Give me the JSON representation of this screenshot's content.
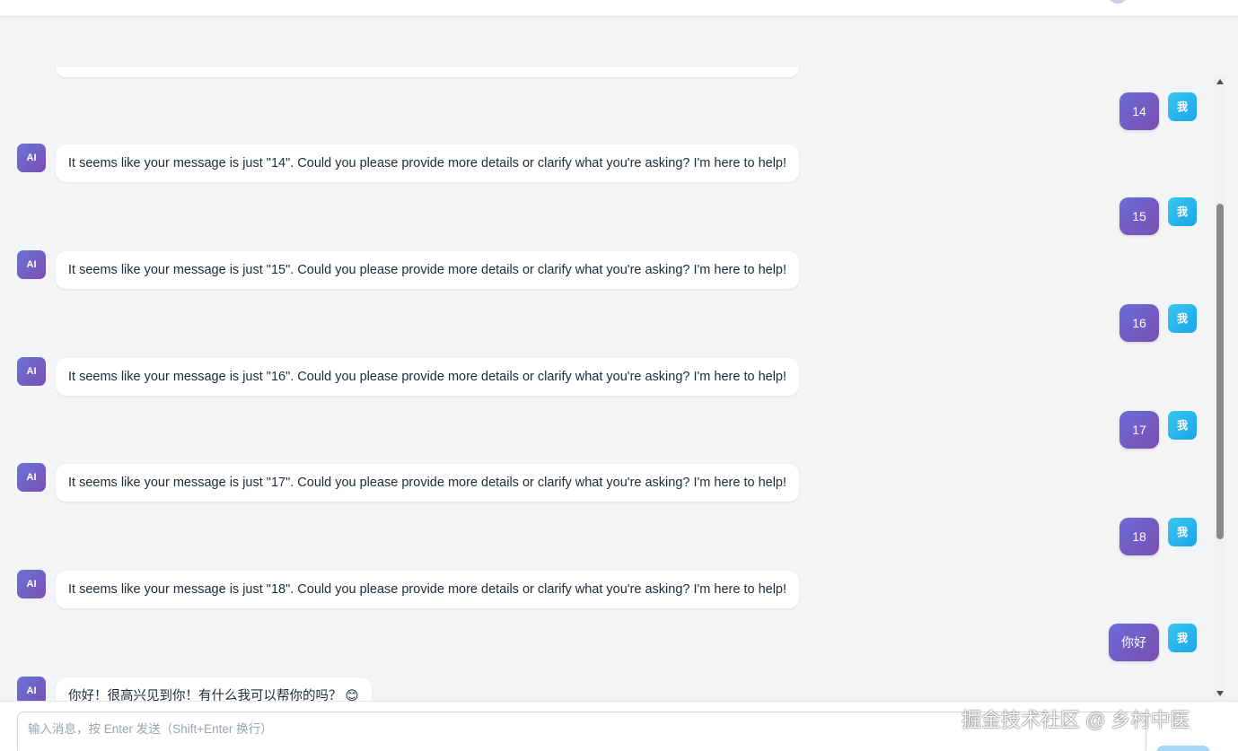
{
  "conversation": {
    "user_avatar_label": "我",
    "ai_avatar_label": "AI",
    "messages": [
      {
        "role": "user",
        "text": "14"
      },
      {
        "role": "assistant",
        "text": "It seems like your message is just \"14\". Could you please provide more details or clarify what you're asking? I'm here to help!"
      },
      {
        "role": "user",
        "text": "15"
      },
      {
        "role": "assistant",
        "text": "It seems like your message is just \"15\". Could you please provide more details or clarify what you're asking? I'm here to help!"
      },
      {
        "role": "user",
        "text": "16"
      },
      {
        "role": "assistant",
        "text": "It seems like your message is just \"16\". Could you please provide more details or clarify what you're asking? I'm here to help!"
      },
      {
        "role": "user",
        "text": "17"
      },
      {
        "role": "assistant",
        "text": "It seems like your message is just \"17\". Could you please provide more details or clarify what you're asking? I'm here to help!"
      },
      {
        "role": "user",
        "text": "18"
      },
      {
        "role": "assistant",
        "text": "It seems like your message is just \"18\". Could you please provide more details or clarify what you're asking? I'm here to help!"
      },
      {
        "role": "user",
        "text": "你好"
      },
      {
        "role": "assistant",
        "text": "你好！很高兴见到你！有什么我可以帮你的吗？ 😊"
      }
    ]
  },
  "composer": {
    "placeholder": "输入消息，按 Enter 发送（Shift+Enter 换行）",
    "value": ""
  },
  "watermark": "掘金技术社区 @ 乡村中医",
  "colors": {
    "user_bubble": "#6c6bd8",
    "user_avatar": "#38c8f0",
    "ai_avatar": "#6c72d8",
    "background": "#f3f4f6",
    "send_button": "#a9d6f5"
  }
}
